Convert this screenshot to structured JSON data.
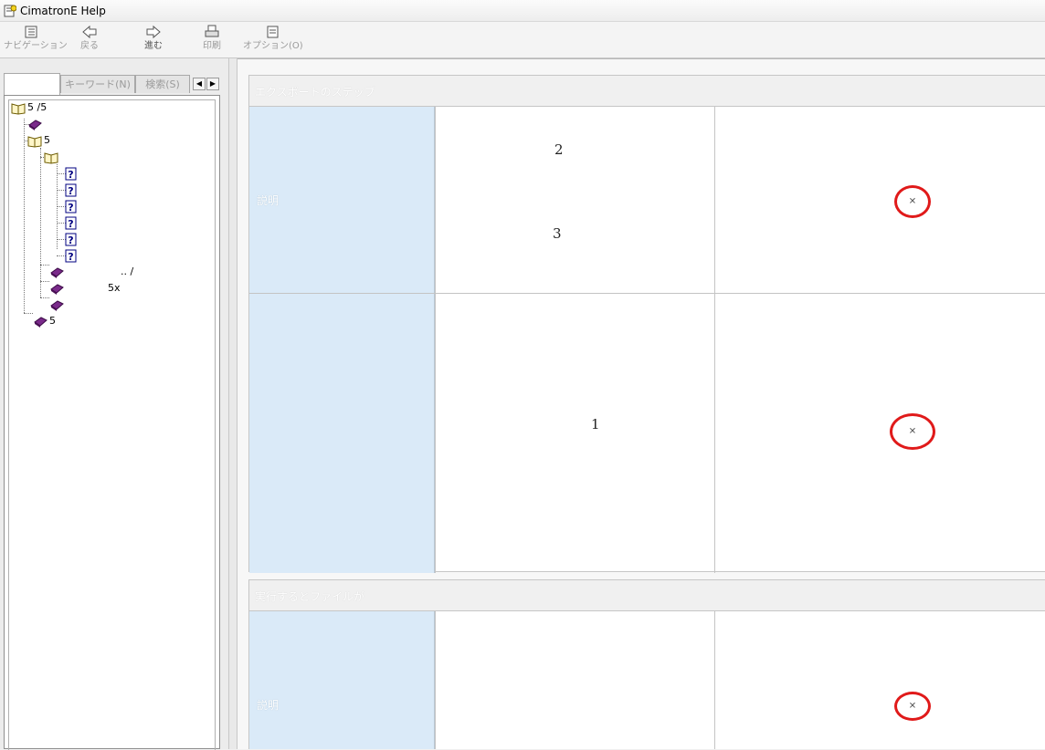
{
  "window": {
    "title": "CimatronE Help"
  },
  "toolbar": {
    "buttons": [
      {
        "label": "ナビゲーション",
        "icon": "contents-icon"
      },
      {
        "label": "戻る",
        "icon": "back-arrow-icon"
      },
      {
        "label": "進む",
        "icon": "forward-arrow-icon"
      },
      {
        "label": "印刷",
        "icon": "print-icon"
      },
      {
        "label": "オプション(O)",
        "icon": "options-icon"
      }
    ]
  },
  "left": {
    "tabs": [
      {
        "label": ""
      },
      {
        "label": "キーワード(N)"
      },
      {
        "label": "検索(S)"
      }
    ],
    "tree": [
      {
        "label": "5                              /5",
        "icon": "open-book-icon"
      },
      {
        "label": "",
        "icon": "book-icon"
      },
      {
        "label": "5",
        "icon": "open-book-icon"
      },
      {
        "label": "",
        "icon": "open-book-icon"
      },
      {
        "label": "",
        "icon": "help-page-icon"
      },
      {
        "label": "",
        "icon": "help-page-icon"
      },
      {
        "label": "",
        "icon": "help-page-icon"
      },
      {
        "label": "",
        "icon": "help-page-icon"
      },
      {
        "label": "",
        "icon": "help-page-icon"
      },
      {
        "label": "",
        "icon": "help-page-icon"
      },
      {
        "label": "..                         /",
        "icon": "book-icon"
      },
      {
        "label": "5x",
        "icon": "book-icon"
      },
      {
        "label": "",
        "icon": "book-icon"
      },
      {
        "label": "5",
        "icon": "book-icon"
      }
    ]
  },
  "content": {
    "section1": {
      "header": "エクスポートのステップ",
      "row1": {
        "label": "説明",
        "num_a": "2",
        "num_b": "3"
      },
      "row2": {
        "label": "",
        "num": "1"
      }
    },
    "section2": {
      "header": "実行するとファイルが",
      "row1": {
        "label": "説明"
      }
    },
    "mark_color": "#e01a1a"
  }
}
